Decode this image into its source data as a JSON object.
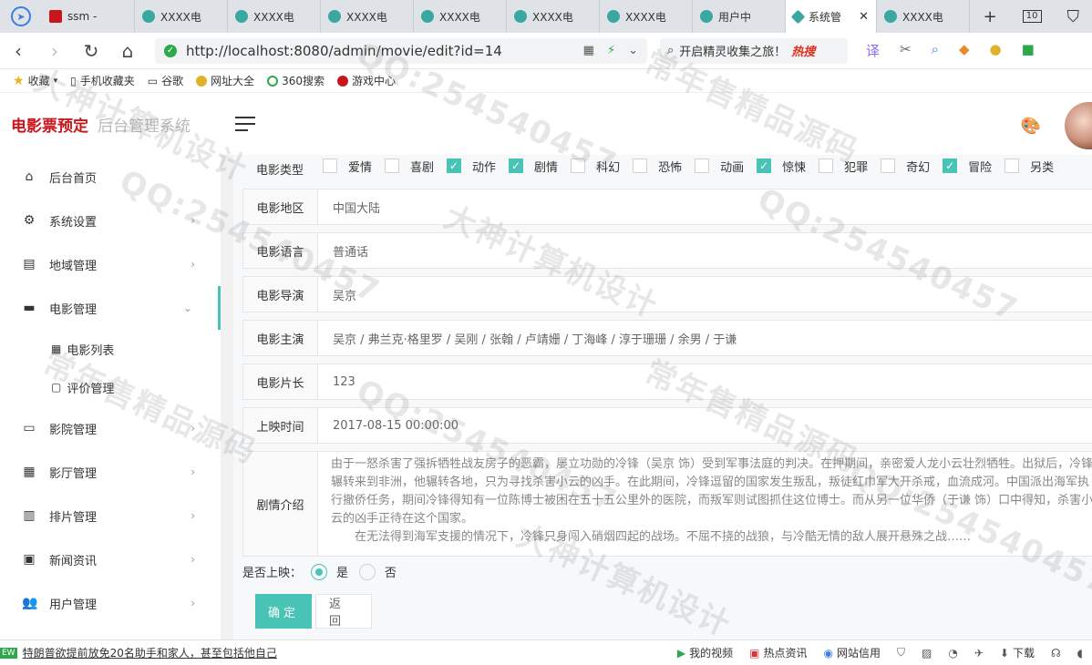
{
  "browser": {
    "tabs": [
      {
        "label": "ssm -",
        "icon": "red"
      },
      {
        "label": "XXXX电",
        "icon": "green"
      },
      {
        "label": "XXXX电",
        "icon": "green"
      },
      {
        "label": "XXXX电",
        "icon": "green"
      },
      {
        "label": "XXXX电",
        "icon": "green"
      },
      {
        "label": "XXXX电",
        "icon": "green"
      },
      {
        "label": "XXXX电",
        "icon": "green"
      },
      {
        "label": "用户中",
        "icon": "green"
      },
      {
        "label": "系统管",
        "icon": "diamond",
        "close": "✕"
      },
      {
        "label": "XXXX电",
        "icon": "green"
      }
    ],
    "new_tab": "+",
    "tab_count": "10",
    "url": "http://localhost:8080/admin/movie/edit?id=14",
    "search_placeholder": "开启精灵收集之旅！",
    "search_hot": "热搜",
    "bookmarks": [
      {
        "label": "收藏",
        "icon": "star-icon"
      },
      {
        "label": "手机收藏夹",
        "icon": "phone-icon"
      },
      {
        "label": "谷歌",
        "icon": "doc-icon"
      },
      {
        "label": "网址大全",
        "icon": "globe-icon"
      },
      {
        "label": "360搜索",
        "icon": "360-icon"
      },
      {
        "label": "游戏中心",
        "icon": "game-icon"
      }
    ]
  },
  "app": {
    "brand": "电影票预定",
    "subtitle": "后台管理系统"
  },
  "sidebar": {
    "items": [
      {
        "label": "后台首页",
        "icon": "home-icon",
        "glyph": "⌂",
        "chevron": ""
      },
      {
        "label": "系统设置",
        "icon": "gear-icon",
        "glyph": "⚙",
        "chevron": "›"
      },
      {
        "label": "地域管理",
        "icon": "map-icon",
        "glyph": "▤",
        "chevron": "›"
      },
      {
        "label": "电影管理",
        "icon": "film-icon",
        "glyph": "▬",
        "chevron": "⌄"
      },
      {
        "label": "影院管理",
        "icon": "store-icon",
        "glyph": "▭",
        "chevron": "›"
      },
      {
        "label": "影厅管理",
        "icon": "building-icon",
        "glyph": "▦",
        "chevron": "›"
      },
      {
        "label": "排片管理",
        "icon": "schedule-icon",
        "glyph": "▥",
        "chevron": "›"
      },
      {
        "label": "新闻资讯",
        "icon": "news-icon",
        "glyph": "▣",
        "chevron": "›"
      },
      {
        "label": "用户管理",
        "icon": "users-icon",
        "glyph": "👥",
        "chevron": "›"
      }
    ],
    "submenu": [
      {
        "label": "电影列表",
        "icon": "grid-icon",
        "glyph": "▦"
      },
      {
        "label": "评价管理",
        "icon": "comment-icon",
        "glyph": "▢"
      }
    ]
  },
  "form": {
    "type_label": "电影类型",
    "types": [
      {
        "label": "爱情",
        "checked": false
      },
      {
        "label": "喜剧",
        "checked": false
      },
      {
        "label": "动作",
        "checked": true
      },
      {
        "label": "剧情",
        "checked": true
      },
      {
        "label": "科幻",
        "checked": false
      },
      {
        "label": "恐怖",
        "checked": false
      },
      {
        "label": "动画",
        "checked": false
      },
      {
        "label": "惊悚",
        "checked": true
      },
      {
        "label": "犯罪",
        "checked": false
      },
      {
        "label": "奇幻",
        "checked": false
      },
      {
        "label": "冒险",
        "checked": true
      },
      {
        "label": "另类",
        "checked": false
      }
    ],
    "region_label": "电影地区",
    "region": "中国大陆",
    "language_label": "电影语言",
    "language": "普通话",
    "director_label": "电影导演",
    "director": "吴京",
    "actors_label": "电影主演",
    "actors": "吴京 / 弗兰克·格里罗 / 吴刚 / 张翰 / 卢靖姗 / 丁海峰 / 淳于珊珊 / 余男 / 于谦",
    "duration_label": "电影片长",
    "duration": "123",
    "release_label": "上映时间",
    "release_time": "2017-08-15 00:00:00",
    "intro_label": "剧情介绍",
    "intro_p1": "由于一怒杀害了强拆牺牲战友房子的恶霸，屡立功勋的冷锋（吴京 饰）受到军事法庭的判决。在押期间，亲密爱人龙小云壮烈牺牲。出狱后，冷锋辗转来到非洲，他辗转各地，只为寻找杀害小云的凶手。在此期间，冷锋逗留的国家发生叛乱，叛徒红巾军大开杀戒，血流成河。中国派出海军执行撤侨任务，期间冷锋得知有一位陈博士被困在五十五公里外的医院，而叛军则试图抓住这位博士。而从另一位华侨（于谦 饰）口中得知，杀害小云的凶手正待在这个国家。",
    "intro_p2": "在无法得到海军支援的情况下，冷锋只身闯入硝烟四起的战场。不屈不挠的战狼，与冷酷无情的敌人展开悬殊之战……",
    "on_air_label": "是否上映：",
    "yes": "是",
    "no": "否",
    "confirm": "确定",
    "back": "返回"
  },
  "statusbar": {
    "news_tag": "EW",
    "news": "特朗普欲提前放免20名助手和家人，甚至包括他自己",
    "items": [
      {
        "label": "我的视频",
        "icon": "video-icon"
      },
      {
        "label": "热点资讯",
        "icon": "hot-news-icon"
      },
      {
        "label": "网站信用",
        "icon": "credit-icon"
      },
      {
        "label": "下载",
        "icon": "download-icon"
      }
    ]
  },
  "watermarks": [
    "QQ:254540457",
    "常年售精品源码",
    "大神计算机设计"
  ],
  "colors": {
    "accent": "#49c3b5",
    "brand": "#c8161d"
  }
}
